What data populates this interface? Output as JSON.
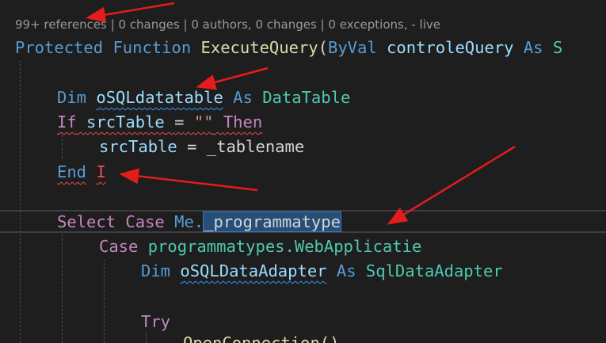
{
  "codelens": {
    "text": "99+ references | 0 changes | 0 authors, 0 changes | 0 exceptions, - live"
  },
  "code": {
    "l1": {
      "protected": "Protected",
      "function": "Function",
      "name": "ExecuteQuery",
      "paren": "(",
      "byval": "ByVal",
      "param": "controleQuery",
      "as": "As",
      "type_partial": "S"
    },
    "l2": {
      "dim": "Dim",
      "var": "oSQLdatatable",
      "as": "As",
      "type": "DataTable"
    },
    "l3": {
      "if": "If",
      "var": "srcTable",
      "op": "=",
      "str": "\"\"",
      "then": "Then"
    },
    "l4": {
      "var": "srcTable",
      "op": "=",
      "val": "_tablename"
    },
    "l5": {
      "end": "End",
      "err": "I"
    },
    "l6": {
      "select": "Select",
      "case": "Case",
      "me": "Me.",
      "prop": "_programmatype"
    },
    "l7": {
      "case": "Case",
      "expr": "programmatypes.WebApplicatie"
    },
    "l8": {
      "dim": "Dim",
      "var": "oSQLDataAdapter",
      "as": "As",
      "type": "SqlDataAdapter"
    },
    "l9": {
      "try": "Try"
    },
    "l10": {
      "partial": "OpenConnection()"
    }
  },
  "colors": {
    "background": "#1e1e1e",
    "annotation_arrow": "#e51c1c",
    "selection": "#264f78"
  }
}
